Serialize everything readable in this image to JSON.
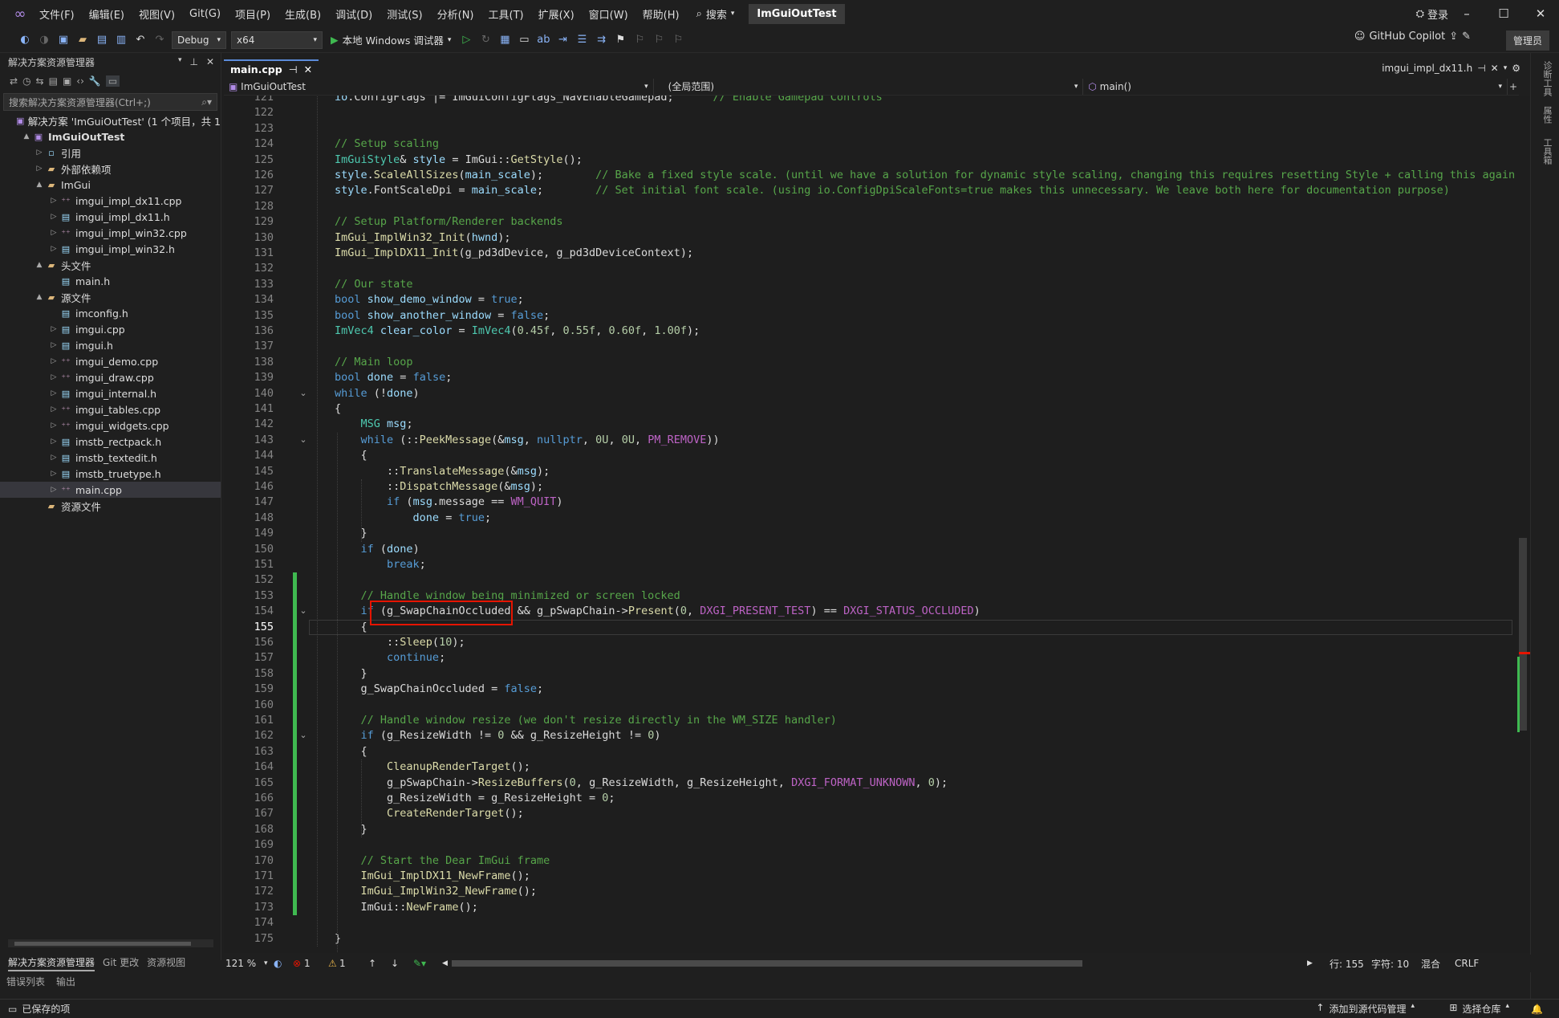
{
  "menu": {
    "items": [
      "文件(F)",
      "编辑(E)",
      "视图(V)",
      "Git(G)",
      "项目(P)",
      "生成(B)",
      "调试(D)",
      "测试(S)",
      "分析(N)",
      "工具(T)",
      "扩展(X)",
      "窗口(W)",
      "帮助(H)"
    ],
    "search": "搜索",
    "solution_title": "ImGuiOutTest",
    "login": "登录"
  },
  "toolbar": {
    "config": "Debug",
    "platform": "x64",
    "run_label": "本地 Windows 调试器",
    "copilot": "GitHub Copilot",
    "admin": "管理员"
  },
  "sidebar": {
    "title": "解决方案资源管理器",
    "search_placeholder": "搜索解决方案资源管理器(Ctrl+;)",
    "tree": [
      {
        "label": "解决方案 'ImGuiOutTest' (1 个项目，共 1",
        "icon": "sol"
      },
      {
        "label": "ImGuiOutTest",
        "icon": "proj",
        "bold": true
      },
      {
        "label": "引用",
        "icon": "ref"
      },
      {
        "label": "外部依赖项",
        "icon": "folder"
      },
      {
        "label": "ImGui",
        "icon": "folder"
      },
      {
        "label": "imgui_impl_dx11.cpp",
        "icon": "cpp"
      },
      {
        "label": "imgui_impl_dx11.h",
        "icon": "h"
      },
      {
        "label": "imgui_impl_win32.cpp",
        "icon": "cpp"
      },
      {
        "label": "imgui_impl_win32.h",
        "icon": "h"
      },
      {
        "label": "头文件",
        "icon": "folder"
      },
      {
        "label": "main.h",
        "icon": "h"
      },
      {
        "label": "源文件",
        "icon": "folder"
      },
      {
        "label": "imconfig.h",
        "icon": "h"
      },
      {
        "label": "imgui.cpp",
        "icon": "h"
      },
      {
        "label": "imgui.h",
        "icon": "h"
      },
      {
        "label": "imgui_demo.cpp",
        "icon": "cpp"
      },
      {
        "label": "imgui_draw.cpp",
        "icon": "cpp"
      },
      {
        "label": "imgui_internal.h",
        "icon": "h"
      },
      {
        "label": "imgui_tables.cpp",
        "icon": "cpp"
      },
      {
        "label": "imgui_widgets.cpp",
        "icon": "cpp"
      },
      {
        "label": "imstb_rectpack.h",
        "icon": "h"
      },
      {
        "label": "imstb_textedit.h",
        "icon": "h"
      },
      {
        "label": "imstb_truetype.h",
        "icon": "h"
      },
      {
        "label": "main.cpp",
        "icon": "cpp",
        "selected": true
      },
      {
        "label": "资源文件",
        "icon": "folder"
      }
    ],
    "bottom_tabs": [
      "解决方案资源管理器",
      "Git 更改",
      "资源视图"
    ]
  },
  "editor": {
    "active_tab": "main.cpp",
    "right_tab": "imgui_impl_dx11.h",
    "nav_project": "ImGuiOutTest",
    "nav_scope": "(全局范围)",
    "nav_member": "main()",
    "zoom": "121 %",
    "errors": "1",
    "warnings": "1",
    "line": "行: 155",
    "col": "字符: 10",
    "mode": "混合",
    "eol": "CRLF",
    "lines": [
      {
        "n": 121,
        "t": "io.ConfigFlags |= ImGuiConfigFlags_NavEnableGamepad;      // Enable Gamepad Controls"
      },
      {
        "n": 122,
        "t": ""
      },
      {
        "n": 123,
        "t": ""
      },
      {
        "n": 124,
        "t": "// Setup scaling"
      },
      {
        "n": 125,
        "t": "ImGuiStyle& style = ImGui::GetStyle();"
      },
      {
        "n": 126,
        "t": "style.ScaleAllSizes(main_scale);        // Bake a fixed style scale. (until we have a solution for dynamic style scaling, changing this requires resetting Style + calling this again)"
      },
      {
        "n": 127,
        "t": "style.FontScaleDpi = main_scale;        // Set initial font scale. (using io.ConfigDpiScaleFonts=true makes this unnecessary. We leave both here for documentation purpose)"
      },
      {
        "n": 128,
        "t": ""
      },
      {
        "n": 129,
        "t": "// Setup Platform/Renderer backends"
      },
      {
        "n": 130,
        "t": "ImGui_ImplWin32_Init(hwnd);"
      },
      {
        "n": 131,
        "t": "ImGui_ImplDX11_Init(g_pd3dDevice, g_pd3dDeviceContext);"
      },
      {
        "n": 132,
        "t": ""
      },
      {
        "n": 133,
        "t": "// Our state"
      },
      {
        "n": 134,
        "t": "bool show_demo_window = true;"
      },
      {
        "n": 135,
        "t": "bool show_another_window = false;"
      },
      {
        "n": 136,
        "t": "ImVec4 clear_color = ImVec4(0.45f, 0.55f, 0.60f, 1.00f);"
      },
      {
        "n": 137,
        "t": ""
      },
      {
        "n": 138,
        "t": "// Main loop"
      },
      {
        "n": 139,
        "t": "bool done = false;"
      },
      {
        "n": 140,
        "t": "while (!done)"
      },
      {
        "n": 141,
        "t": "{"
      },
      {
        "n": 142,
        "t": "    MSG msg;"
      },
      {
        "n": 143,
        "t": "    while (::PeekMessage(&msg, nullptr, 0U, 0U, PM_REMOVE))"
      },
      {
        "n": 144,
        "t": "    {"
      },
      {
        "n": 145,
        "t": "        ::TranslateMessage(&msg);"
      },
      {
        "n": 146,
        "t": "        ::DispatchMessage(&msg);"
      },
      {
        "n": 147,
        "t": "        if (msg.message == WM_QUIT)"
      },
      {
        "n": 148,
        "t": "            done = true;"
      },
      {
        "n": 149,
        "t": "    }"
      },
      {
        "n": 150,
        "t": "    if (done)"
      },
      {
        "n": 151,
        "t": "        break;"
      },
      {
        "n": 152,
        "t": ""
      },
      {
        "n": 153,
        "t": "    // Handle window being minimized or screen locked"
      },
      {
        "n": 154,
        "t": "    if (g_SwapChainOccluded && g_pSwapChain->Present(0, DXGI_PRESENT_TEST) == DXGI_STATUS_OCCLUDED)"
      },
      {
        "n": 155,
        "t": "    {"
      },
      {
        "n": 156,
        "t": "        ::Sleep(10);"
      },
      {
        "n": 157,
        "t": "        continue;"
      },
      {
        "n": 158,
        "t": "    }"
      },
      {
        "n": 159,
        "t": "    g_SwapChainOccluded = false;"
      },
      {
        "n": 160,
        "t": ""
      },
      {
        "n": 161,
        "t": "    // Handle window resize (we don't resize directly in the WM_SIZE handler)"
      },
      {
        "n": 162,
        "t": "    if (g_ResizeWidth != 0 && g_ResizeHeight != 0)"
      },
      {
        "n": 163,
        "t": "    {"
      },
      {
        "n": 164,
        "t": "        CleanupRenderTarget();"
      },
      {
        "n": 165,
        "t": "        g_pSwapChain->ResizeBuffers(0, g_ResizeWidth, g_ResizeHeight, DXGI_FORMAT_UNKNOWN, 0);"
      },
      {
        "n": 166,
        "t": "        g_ResizeWidth = g_ResizeHeight = 0;"
      },
      {
        "n": 167,
        "t": "        CreateRenderTarget();"
      },
      {
        "n": 168,
        "t": "    }"
      },
      {
        "n": 169,
        "t": ""
      },
      {
        "n": 170,
        "t": "    // Start the Dear ImGui frame"
      },
      {
        "n": 171,
        "t": "    ImGui_ImplDX11_NewFrame();"
      },
      {
        "n": 172,
        "t": "    ImGui_ImplWin32_NewFrame();"
      },
      {
        "n": 173,
        "t": "    ImGui::NewFrame();"
      },
      {
        "n": 174,
        "t": ""
      },
      {
        "n": 175,
        "t": "}"
      }
    ]
  },
  "panels": {
    "error_list": "错误列表",
    "output": "输出"
  },
  "status": {
    "saved": "已保存的项",
    "add_to_source": "添加到源代码管理",
    "select_repo": "选择仓库"
  },
  "rightstrip": [
    "诊断工具",
    "属性",
    "工具箱"
  ]
}
